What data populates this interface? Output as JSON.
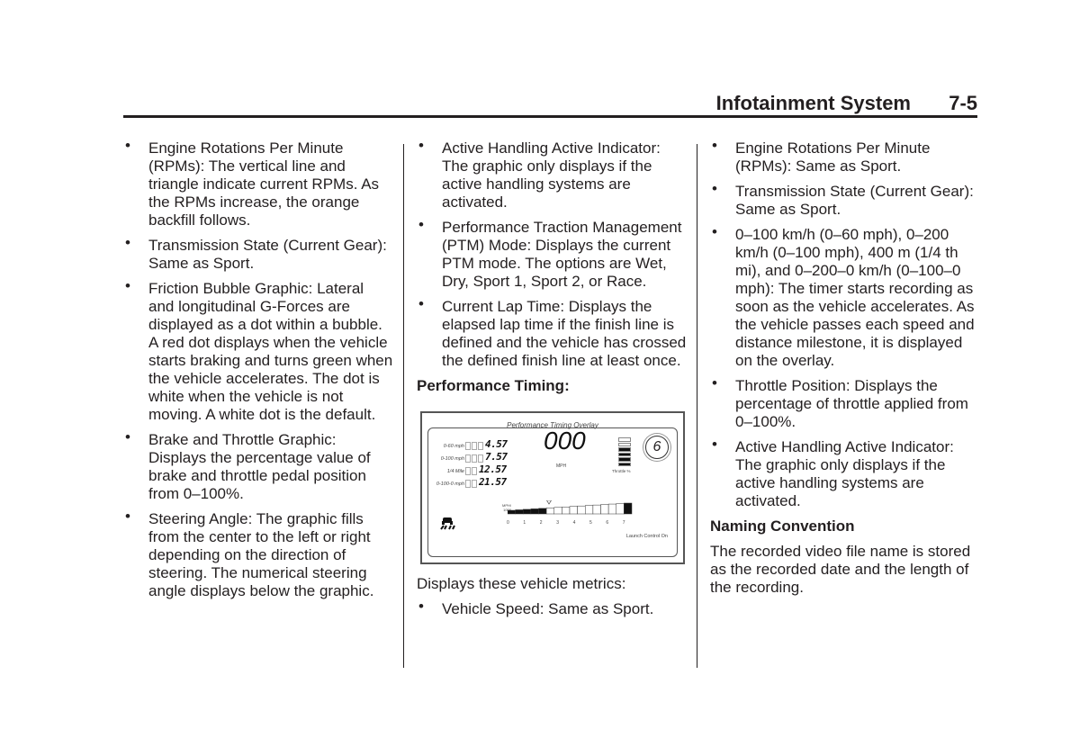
{
  "header": {
    "title": "Infotainment System",
    "page": "7-5"
  },
  "column1": {
    "bullets": [
      "Engine Rotations Per Minute (RPMs): The vertical line and triangle indicate current RPMs. As the RPMs increase, the orange backfill follows.",
      "Transmission State (Current Gear): Same as Sport.",
      "Friction Bubble Graphic: Lateral and longitudinal G-Forces are displayed as a dot within a bubble. A red dot displays when the vehicle starts braking and turns green when the vehicle accelerates. The dot is white when the vehicle is not moving. A white dot is the default.",
      "Brake and Throttle Graphic: Displays the percentage value of brake and throttle pedal position from 0–100%.",
      "Steering Angle: The graphic fills from the center to the left or right depending on the direction of steering. The numerical steering angle displays below the graphic."
    ]
  },
  "column2": {
    "bullets": [
      "Active Handling Active Indicator: The graphic only displays if the active handling systems are activated.",
      "Performance Traction Management (PTM) Mode: Displays the current PTM mode. The options are Wet, Dry, Sport 1, Sport 2, or Race.",
      "Current Lap Time: Displays the elapsed lap time if the finish line is defined and the vehicle has crossed the defined finish line at least once."
    ],
    "heading": "Performance Timing:",
    "figure": {
      "title": "Performance Timing Overlay",
      "timers": [
        {
          "label": "0-60 mph",
          "value": "4.57"
        },
        {
          "label": "0-100 mph",
          "value": "7.57"
        },
        {
          "label": "1/4 Mile",
          "value": "12.57"
        },
        {
          "label": "0-100-0 mph",
          "value": "21.57"
        }
      ],
      "speed": "000",
      "speed_unit": "MPH",
      "throttle_label": "Throttle %",
      "throttle_fraction": 0.6,
      "gear": "6",
      "rpm_label": "MPH/ 1000",
      "rpm_ticks": [
        "0",
        "1",
        "2",
        "3",
        "4",
        "5",
        "6",
        "7"
      ],
      "rpm_value": 2.5,
      "launch_control": "Launch Control On",
      "active_handling_icon": "traction-control-icon"
    },
    "intro": "Displays these vehicle metrics:",
    "metrics": [
      "Vehicle Speed: Same as Sport."
    ]
  },
  "column3": {
    "bullets": [
      "Engine Rotations Per Minute (RPMs): Same as Sport.",
      "Transmission State (Current Gear): Same as Sport.",
      "0–100 km/h (0–60 mph), 0–200 km/h (0–100 mph), 400 m (1/4 th mi), and 0–200–0 km/h (0–100–0 mph): The timer starts recording as soon as the vehicle accelerates. As the vehicle passes each speed and distance milestone, it is displayed on the overlay.",
      "Throttle Position: Displays the percentage of throttle applied from 0–100%.",
      "Active Handling Active Indicator: The graphic only displays if the active handling systems are activated."
    ],
    "heading": "Naming Convention",
    "paragraph": "The recorded video file name is stored as the recorded date and the length of the recording."
  },
  "bullet_glyph": "•"
}
